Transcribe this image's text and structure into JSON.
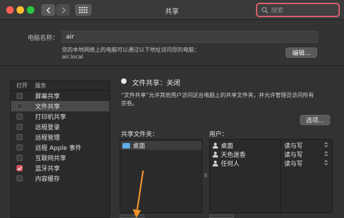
{
  "window": {
    "title": "共享",
    "search_placeholder": "搜索"
  },
  "computer": {
    "name_label": "电脑名称：",
    "name_value": "air",
    "info_line1": "您的本地网络上的电脑可以通过以下地址访问您的电脑：",
    "info_line2": "air.local",
    "edit_button": "编辑..."
  },
  "services": {
    "col_on": "打开",
    "col_service": "服务",
    "items": [
      {
        "label": "屏幕共享",
        "checked": false,
        "selected": false
      },
      {
        "label": "文件共享",
        "checked": false,
        "selected": true
      },
      {
        "label": "打印机共享",
        "checked": false,
        "selected": false
      },
      {
        "label": "远程登录",
        "checked": false,
        "selected": false
      },
      {
        "label": "远程管理",
        "checked": false,
        "selected": false
      },
      {
        "label": "远程 Apple 事件",
        "checked": false,
        "selected": false
      },
      {
        "label": "互联网共享",
        "checked": false,
        "selected": false
      },
      {
        "label": "蓝牙共享",
        "checked": true,
        "selected": false
      },
      {
        "label": "内容缓存",
        "checked": false,
        "selected": false
      }
    ]
  },
  "file_sharing": {
    "status": "文件共享：关闭",
    "desc_line1": "“文件共享”允许其他用户访问这台电脑上的共享文件夹，并允许管理员访问所有",
    "desc_line2": "宗卷。",
    "options_button": "选项...",
    "shared_folders_label": "共享文件夹：",
    "users_label": "用户：",
    "folders": [
      "桌面"
    ],
    "users": [
      {
        "name": "桌面",
        "perm": "读与写",
        "icon": "user-icon"
      },
      {
        "name": "天色迷香",
        "perm": "读与写",
        "icon": "users-icon"
      },
      {
        "name": "任何人",
        "perm": "读与写",
        "icon": "group-icon"
      }
    ]
  },
  "colors": {
    "accent": "#d9606a",
    "checkbox_on": "#d8545e",
    "folder": "#5eaee8",
    "arrow": "#f0932b"
  }
}
